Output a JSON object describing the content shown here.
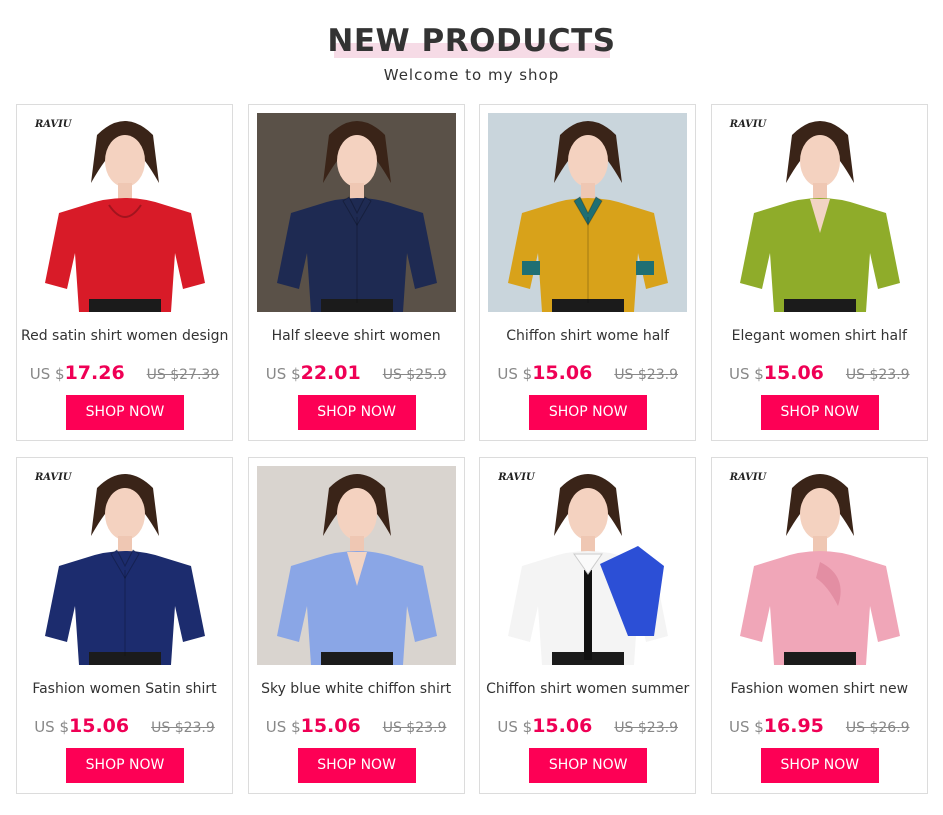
{
  "header": {
    "title": "NEW PRODUCTS",
    "subtitle": "Welcome to my shop"
  },
  "colors": {
    "accent": "#fd0055",
    "price": "#ef0055",
    "highlight": "#f6dbe6"
  },
  "brand_logo": "RAVIU",
  "products": [
    {
      "name": "Red satin shirt women design",
      "currency": "US $",
      "price": "17.26",
      "old_price": "US $27.39",
      "button": "SHOP NOW",
      "branded": true,
      "shirt_color": "#d81b28",
      "bg": "#ffffff",
      "style": "cowl"
    },
    {
      "name": "Half sleeve shirt women",
      "currency": "US $",
      "price": "22.01",
      "old_price": "US $25.9",
      "button": "SHOP NOW",
      "branded": false,
      "shirt_color": "#1e2a52",
      "bg": "#5a5148",
      "style": "collar"
    },
    {
      "name": "Chiffon shirt wome half",
      "currency": "US $",
      "price": "15.06",
      "old_price": "US $23.9",
      "button": "SHOP NOW",
      "branded": false,
      "shirt_color": "#d8a21a",
      "bg": "#c9d5dc",
      "style": "collar-teal"
    },
    {
      "name": "Elegant women shirt half",
      "currency": "US $",
      "price": "15.06",
      "old_price": "US $23.9",
      "button": "SHOP NOW",
      "branded": true,
      "shirt_color": "#8fac2a",
      "bg": "#ffffff",
      "style": "vneck"
    },
    {
      "name": "Fashion women Satin shirt",
      "currency": "US $",
      "price": "15.06",
      "old_price": "US $23.9",
      "button": "SHOP NOW",
      "branded": true,
      "shirt_color": "#1c2c6e",
      "bg": "#ffffff",
      "style": "collar"
    },
    {
      "name": "Sky blue white chiffon shirt",
      "currency": "US $",
      "price": "15.06",
      "old_price": "US $23.9",
      "button": "SHOP NOW",
      "branded": false,
      "shirt_color": "#8aa6e6",
      "bg": "#d9d4cf",
      "style": "vneck"
    },
    {
      "name": "Chiffon shirt women summer",
      "currency": "US $",
      "price": "15.06",
      "old_price": "US $23.9",
      "button": "SHOP NOW",
      "branded": true,
      "shirt_color": "#f4f4f4",
      "bg": "#ffffff",
      "style": "white-blue"
    },
    {
      "name": "Fashion women shirt new",
      "currency": "US $",
      "price": "16.95",
      "old_price": "US $26.9",
      "button": "SHOP NOW",
      "branded": true,
      "shirt_color": "#f0a6b8",
      "bg": "#ffffff",
      "style": "bow"
    }
  ]
}
